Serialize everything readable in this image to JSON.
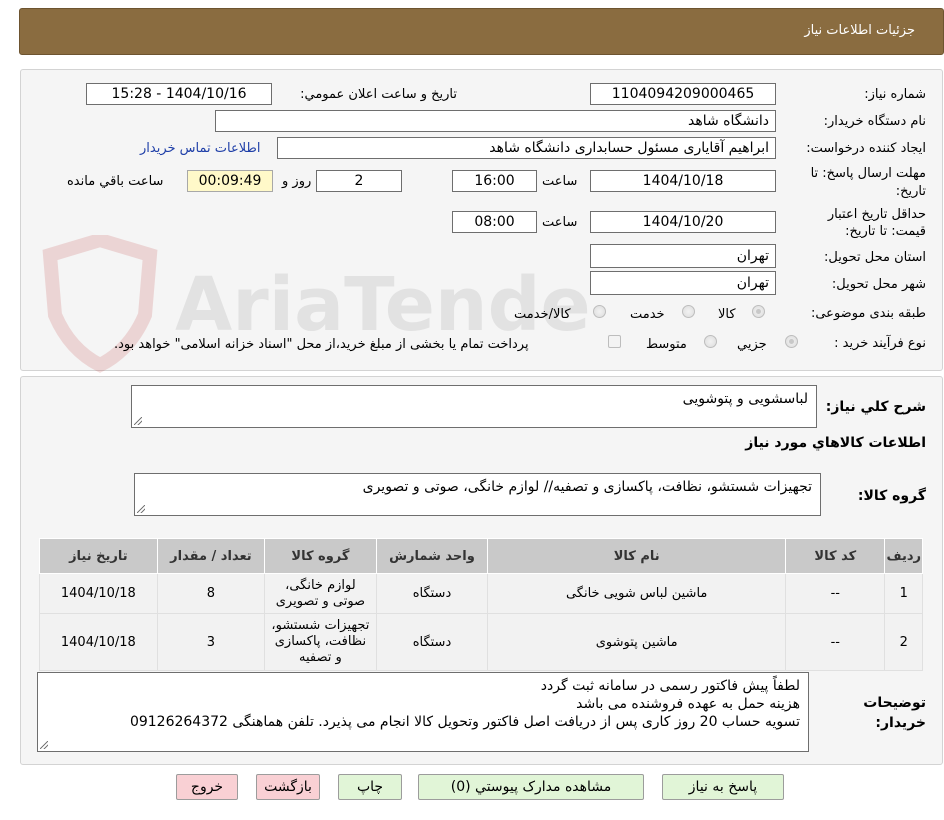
{
  "header": {
    "title": "جزئیات اطلاعات نیاز"
  },
  "watermark": {
    "text": "AriaTender.neT"
  },
  "form": {
    "need_number_label": "شماره نیاز:",
    "need_number": "1104094209000465",
    "announce_label": "تاریخ و ساعت اعلان عمومي:",
    "announce_value": "1404/10/16 - 15:28",
    "buyer_org_label": "نام دستگاه خریدار:",
    "buyer_org": "دانشگاه شاهد",
    "requester_label": "ایجاد کننده درخواست:",
    "requester": "ابراهیم آقایاری مسئول حسابداری دانشگاه شاهد",
    "contact_link": "اطلاعات تماس خریدار",
    "reply_deadline_label": "مهلت ارسال پاسخ: تا تاریخ:",
    "reply_date": "1404/10/18",
    "time_label": "ساعت",
    "reply_time": "16:00",
    "days_value": "2",
    "days_label": "روز و",
    "remaining_time": "00:09:49",
    "remaining_label": "ساعت باقي مانده",
    "validity_label": "حداقل تاریخ اعتبار قیمت: تا تاریخ:",
    "validity_date": "1404/10/20",
    "validity_time": "08:00",
    "province_label": "استان محل تحویل:",
    "province": "تهران",
    "city_label": "شهر محل تحویل:",
    "city": "تهران",
    "category_label": "طبقه بندی موضوعی:",
    "category_options": [
      "کالا",
      "خدمت",
      "کالا/خدمت"
    ],
    "category_selected": "کالا",
    "process_label": "نوع فرآیند خرید :",
    "process_options": [
      "جزیي",
      "متوسط"
    ],
    "process_selected": "جزیي",
    "payment_note": "پرداخت تمام یا بخشی از مبلغ خرید،از محل \"اسناد خزانه اسلامی\" خواهد بود."
  },
  "details": {
    "summary_label": "شرح کلي نیاز:",
    "summary": "لباسشویی و پتوشویی",
    "goods_info_heading": "اطلاعات کالاهاي مورد نیاز",
    "goods_group_label": "گروه کالا:",
    "goods_group": "تجهیزات شستشو، نظافت، پاکسازی و تصفیه// لوازم خانگی، صوتی و تصویری"
  },
  "table": {
    "headers": [
      "ردیف",
      "کد کالا",
      "نام کالا",
      "واحد شمارش",
      "گروه کالا",
      "تعداد / مقدار",
      "تاریخ نیاز"
    ],
    "rows": [
      [
        "1",
        "--",
        "ماشین لباس شویی خانگی",
        "دستگاه",
        "لوازم خانگی، صوتی و تصویری",
        "8",
        "1404/10/18"
      ],
      [
        "2",
        "--",
        "ماشین پتوشوی",
        "دستگاه",
        "تجهیزات شستشو، نظافت، پاکسازی و تصفیه",
        "3",
        "1404/10/18"
      ]
    ]
  },
  "buyer_notes": {
    "label": "توضیحات خریدار:",
    "lines": [
      "لطفاً پیش فاکتور رسمی در سامانه ثبت گردد",
      "هزینه حمل به عهده فروشنده می باشد",
      "تسویه حساب 20 روز کاری پس از دریافت اصل فاکتور وتحویل کالا انجام می پذیرد. تلفن هماهنگی 09126264372"
    ]
  },
  "buttons": {
    "reply": "پاسخ به نیاز",
    "attachments": "مشاهده مدارک پیوستي (0)",
    "print": "چاپ",
    "back": "بازگشت",
    "exit": "خروج"
  },
  "colors": {
    "header_bg": "#8a6c40",
    "link": "#1f3fa8",
    "timer_bg": "#fff9c9",
    "button_green": "#e1f5d7",
    "button_pink": "#f9d0d4"
  }
}
